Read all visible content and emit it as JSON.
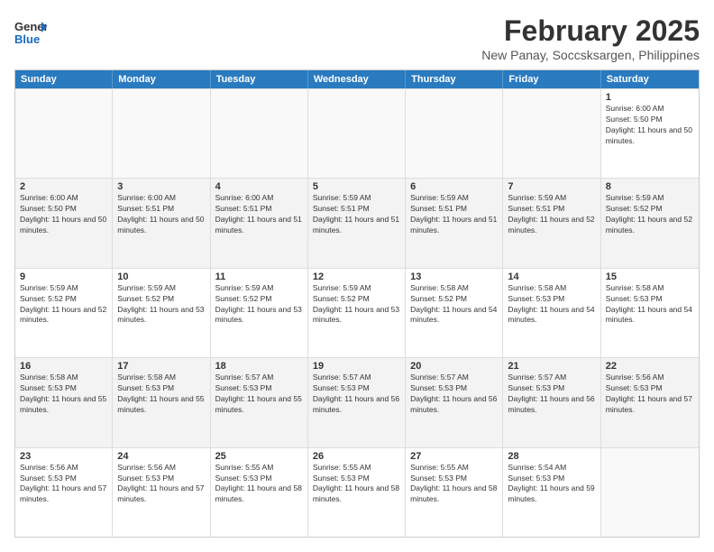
{
  "header": {
    "logo_line1": "General",
    "logo_line2": "Blue",
    "title": "February 2025",
    "subtitle": "New Panay, Soccsksargen, Philippines"
  },
  "days_of_week": [
    "Sunday",
    "Monday",
    "Tuesday",
    "Wednesday",
    "Thursday",
    "Friday",
    "Saturday"
  ],
  "weeks": [
    [
      {
        "day": "",
        "text": ""
      },
      {
        "day": "",
        "text": ""
      },
      {
        "day": "",
        "text": ""
      },
      {
        "day": "",
        "text": ""
      },
      {
        "day": "",
        "text": ""
      },
      {
        "day": "",
        "text": ""
      },
      {
        "day": "1",
        "text": "Sunrise: 6:00 AM\nSunset: 5:50 PM\nDaylight: 11 hours and 50 minutes."
      }
    ],
    [
      {
        "day": "2",
        "text": "Sunrise: 6:00 AM\nSunset: 5:50 PM\nDaylight: 11 hours and 50 minutes."
      },
      {
        "day": "3",
        "text": "Sunrise: 6:00 AM\nSunset: 5:51 PM\nDaylight: 11 hours and 50 minutes."
      },
      {
        "day": "4",
        "text": "Sunrise: 6:00 AM\nSunset: 5:51 PM\nDaylight: 11 hours and 51 minutes."
      },
      {
        "day": "5",
        "text": "Sunrise: 5:59 AM\nSunset: 5:51 PM\nDaylight: 11 hours and 51 minutes."
      },
      {
        "day": "6",
        "text": "Sunrise: 5:59 AM\nSunset: 5:51 PM\nDaylight: 11 hours and 51 minutes."
      },
      {
        "day": "7",
        "text": "Sunrise: 5:59 AM\nSunset: 5:51 PM\nDaylight: 11 hours and 52 minutes."
      },
      {
        "day": "8",
        "text": "Sunrise: 5:59 AM\nSunset: 5:52 PM\nDaylight: 11 hours and 52 minutes."
      }
    ],
    [
      {
        "day": "9",
        "text": "Sunrise: 5:59 AM\nSunset: 5:52 PM\nDaylight: 11 hours and 52 minutes."
      },
      {
        "day": "10",
        "text": "Sunrise: 5:59 AM\nSunset: 5:52 PM\nDaylight: 11 hours and 53 minutes."
      },
      {
        "day": "11",
        "text": "Sunrise: 5:59 AM\nSunset: 5:52 PM\nDaylight: 11 hours and 53 minutes."
      },
      {
        "day": "12",
        "text": "Sunrise: 5:59 AM\nSunset: 5:52 PM\nDaylight: 11 hours and 53 minutes."
      },
      {
        "day": "13",
        "text": "Sunrise: 5:58 AM\nSunset: 5:52 PM\nDaylight: 11 hours and 54 minutes."
      },
      {
        "day": "14",
        "text": "Sunrise: 5:58 AM\nSunset: 5:53 PM\nDaylight: 11 hours and 54 minutes."
      },
      {
        "day": "15",
        "text": "Sunrise: 5:58 AM\nSunset: 5:53 PM\nDaylight: 11 hours and 54 minutes."
      }
    ],
    [
      {
        "day": "16",
        "text": "Sunrise: 5:58 AM\nSunset: 5:53 PM\nDaylight: 11 hours and 55 minutes."
      },
      {
        "day": "17",
        "text": "Sunrise: 5:58 AM\nSunset: 5:53 PM\nDaylight: 11 hours and 55 minutes."
      },
      {
        "day": "18",
        "text": "Sunrise: 5:57 AM\nSunset: 5:53 PM\nDaylight: 11 hours and 55 minutes."
      },
      {
        "day": "19",
        "text": "Sunrise: 5:57 AM\nSunset: 5:53 PM\nDaylight: 11 hours and 56 minutes."
      },
      {
        "day": "20",
        "text": "Sunrise: 5:57 AM\nSunset: 5:53 PM\nDaylight: 11 hours and 56 minutes."
      },
      {
        "day": "21",
        "text": "Sunrise: 5:57 AM\nSunset: 5:53 PM\nDaylight: 11 hours and 56 minutes."
      },
      {
        "day": "22",
        "text": "Sunrise: 5:56 AM\nSunset: 5:53 PM\nDaylight: 11 hours and 57 minutes."
      }
    ],
    [
      {
        "day": "23",
        "text": "Sunrise: 5:56 AM\nSunset: 5:53 PM\nDaylight: 11 hours and 57 minutes."
      },
      {
        "day": "24",
        "text": "Sunrise: 5:56 AM\nSunset: 5:53 PM\nDaylight: 11 hours and 57 minutes."
      },
      {
        "day": "25",
        "text": "Sunrise: 5:55 AM\nSunset: 5:53 PM\nDaylight: 11 hours and 58 minutes."
      },
      {
        "day": "26",
        "text": "Sunrise: 5:55 AM\nSunset: 5:53 PM\nDaylight: 11 hours and 58 minutes."
      },
      {
        "day": "27",
        "text": "Sunrise: 5:55 AM\nSunset: 5:53 PM\nDaylight: 11 hours and 58 minutes."
      },
      {
        "day": "28",
        "text": "Sunrise: 5:54 AM\nSunset: 5:53 PM\nDaylight: 11 hours and 59 minutes."
      },
      {
        "day": "",
        "text": ""
      }
    ]
  ]
}
